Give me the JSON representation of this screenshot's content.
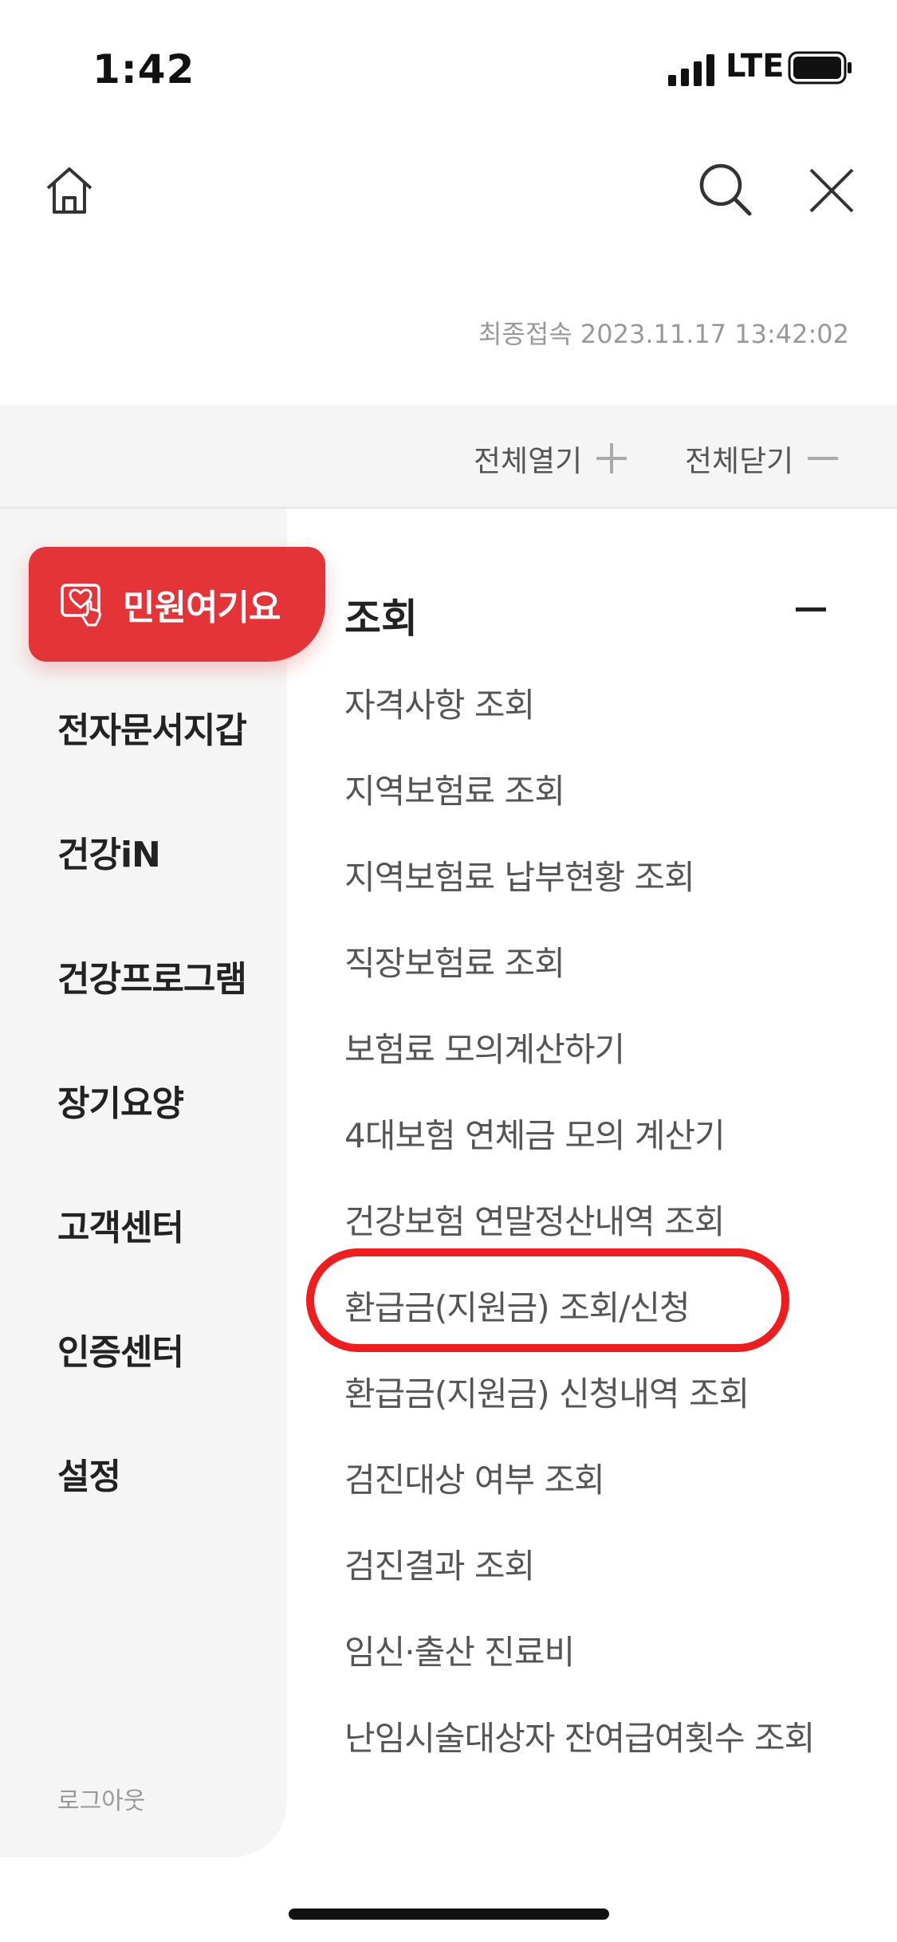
{
  "status_bar": {
    "time": "1:42",
    "network": "LTE"
  },
  "header": {
    "last_access": "최종접속 2023.11.17 13:42:02"
  },
  "toolbar": {
    "expand_all": "전체열기",
    "collapse_all": "전체닫기"
  },
  "sidebar": {
    "active": "민원여기요",
    "items": [
      "전자문서지갑",
      "건강iN",
      "건강프로그램",
      "장기요양",
      "고객센터",
      "인증센터",
      "설정"
    ],
    "logout": "로그아웃"
  },
  "content": {
    "section_title": "조회",
    "items": [
      "자격사항 조회",
      "지역보험료 조회",
      "지역보험료 납부현황 조회",
      "직장보험료 조회",
      "보험료 모의계산하기",
      "4대보험 연체금 모의 계산기",
      "건강보험 연말정산내역 조회",
      "환급금(지원금) 조회/신청",
      "환급금(지원금) 신청내역 조회",
      "검진대상 여부 조회",
      "검진결과 조회",
      "임신·출산 진료비",
      "난임시술대상자 잔여급여횟수 조회"
    ]
  },
  "colors": {
    "accent": "#e43438",
    "highlight_ring": "#ef1d1d"
  },
  "icons": [
    "home-icon",
    "search-icon",
    "close-icon",
    "complaint-heart-icon",
    "plus-icon",
    "minus-icon"
  ]
}
